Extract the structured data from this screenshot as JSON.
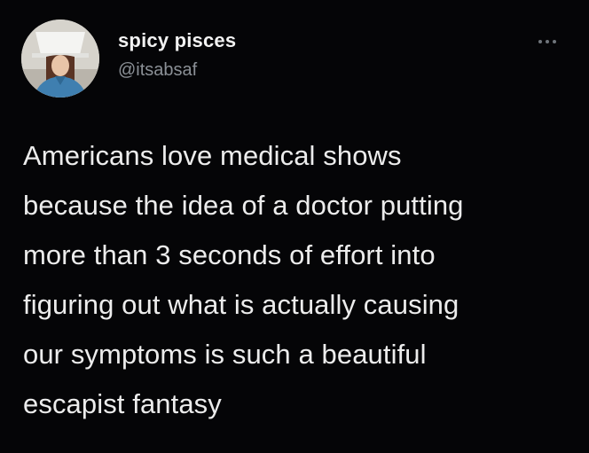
{
  "tweet": {
    "display_name": "spicy pisces",
    "handle": "@itsabsaf",
    "more_icon": "more-horizontal-icon",
    "text_lines": [
      "Americans love medical shows",
      "because the idea of a doctor putting",
      "more than 3 seconds of effort into",
      "figuring out what is actually causing",
      "our symptoms is such a beautiful",
      "escapist fantasy"
    ]
  },
  "colors": {
    "background": "#050507",
    "text": "#ececec",
    "handle": "#8b9096"
  }
}
